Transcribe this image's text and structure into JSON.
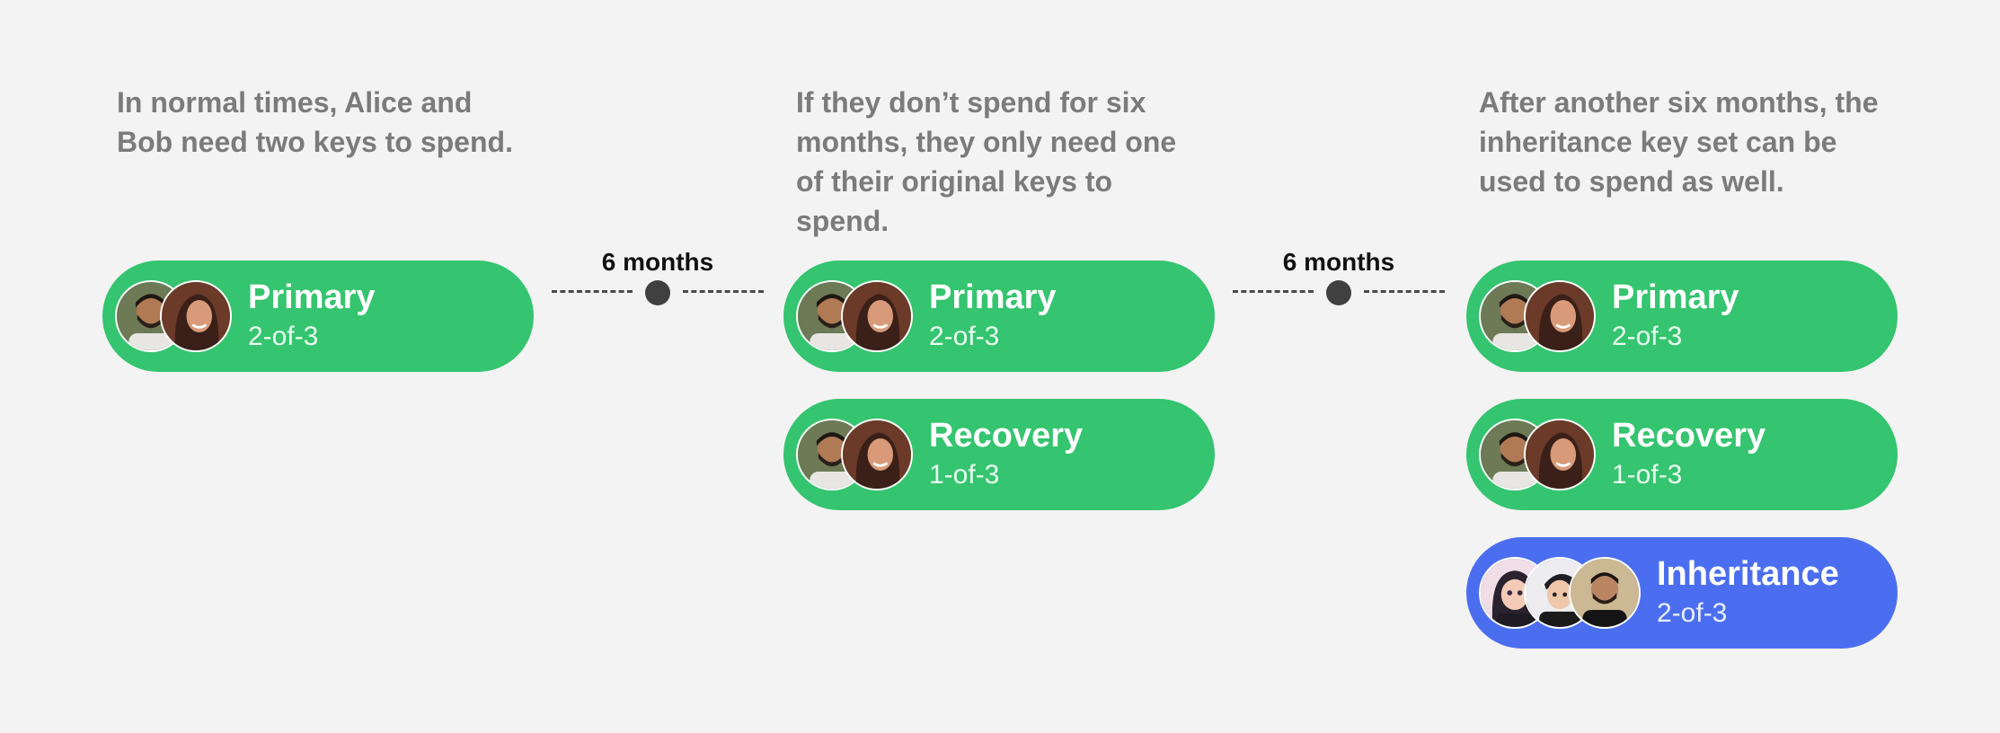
{
  "colors": {
    "background": "#f3f3f3",
    "description_text": "#7b7b7b",
    "key_set_green": "#35c46f",
    "key_set_blue": "#4b6ef0",
    "connector": "#404040"
  },
  "columns": [
    {
      "description": "In normal times, Alice and Bob need two keys to spend.",
      "key_sets": [
        {
          "title": "Primary",
          "threshold": "2-of-3",
          "color": "green",
          "avatars": [
            "man-avatar",
            "woman-avatar"
          ]
        }
      ]
    },
    {
      "description": "If they don’t spend for six months, they only need one of their original keys to spend.",
      "key_sets": [
        {
          "title": "Primary",
          "threshold": "2-of-3",
          "color": "green",
          "avatars": [
            "man-avatar",
            "woman-avatar"
          ]
        },
        {
          "title": "Recovery",
          "threshold": "1-of-3",
          "color": "green",
          "avatars": [
            "man-avatar",
            "woman-avatar"
          ]
        }
      ]
    },
    {
      "description": "After another six months, the inheritance key set can be used to spend as well.",
      "key_sets": [
        {
          "title": "Primary",
          "threshold": "2-of-3",
          "color": "green",
          "avatars": [
            "man-avatar",
            "woman-avatar"
          ]
        },
        {
          "title": "Recovery",
          "threshold": "1-of-3",
          "color": "green",
          "avatars": [
            "man-avatar",
            "woman-avatar"
          ]
        },
        {
          "title": "Inheritance",
          "threshold": "2-of-3",
          "color": "blue",
          "avatars": [
            "cartoon-girl-avatar",
            "cartoon-boy-avatar",
            "bearded-man-avatar"
          ]
        }
      ]
    }
  ],
  "connectors": [
    {
      "label": "6 months"
    },
    {
      "label": "6 months"
    }
  ]
}
